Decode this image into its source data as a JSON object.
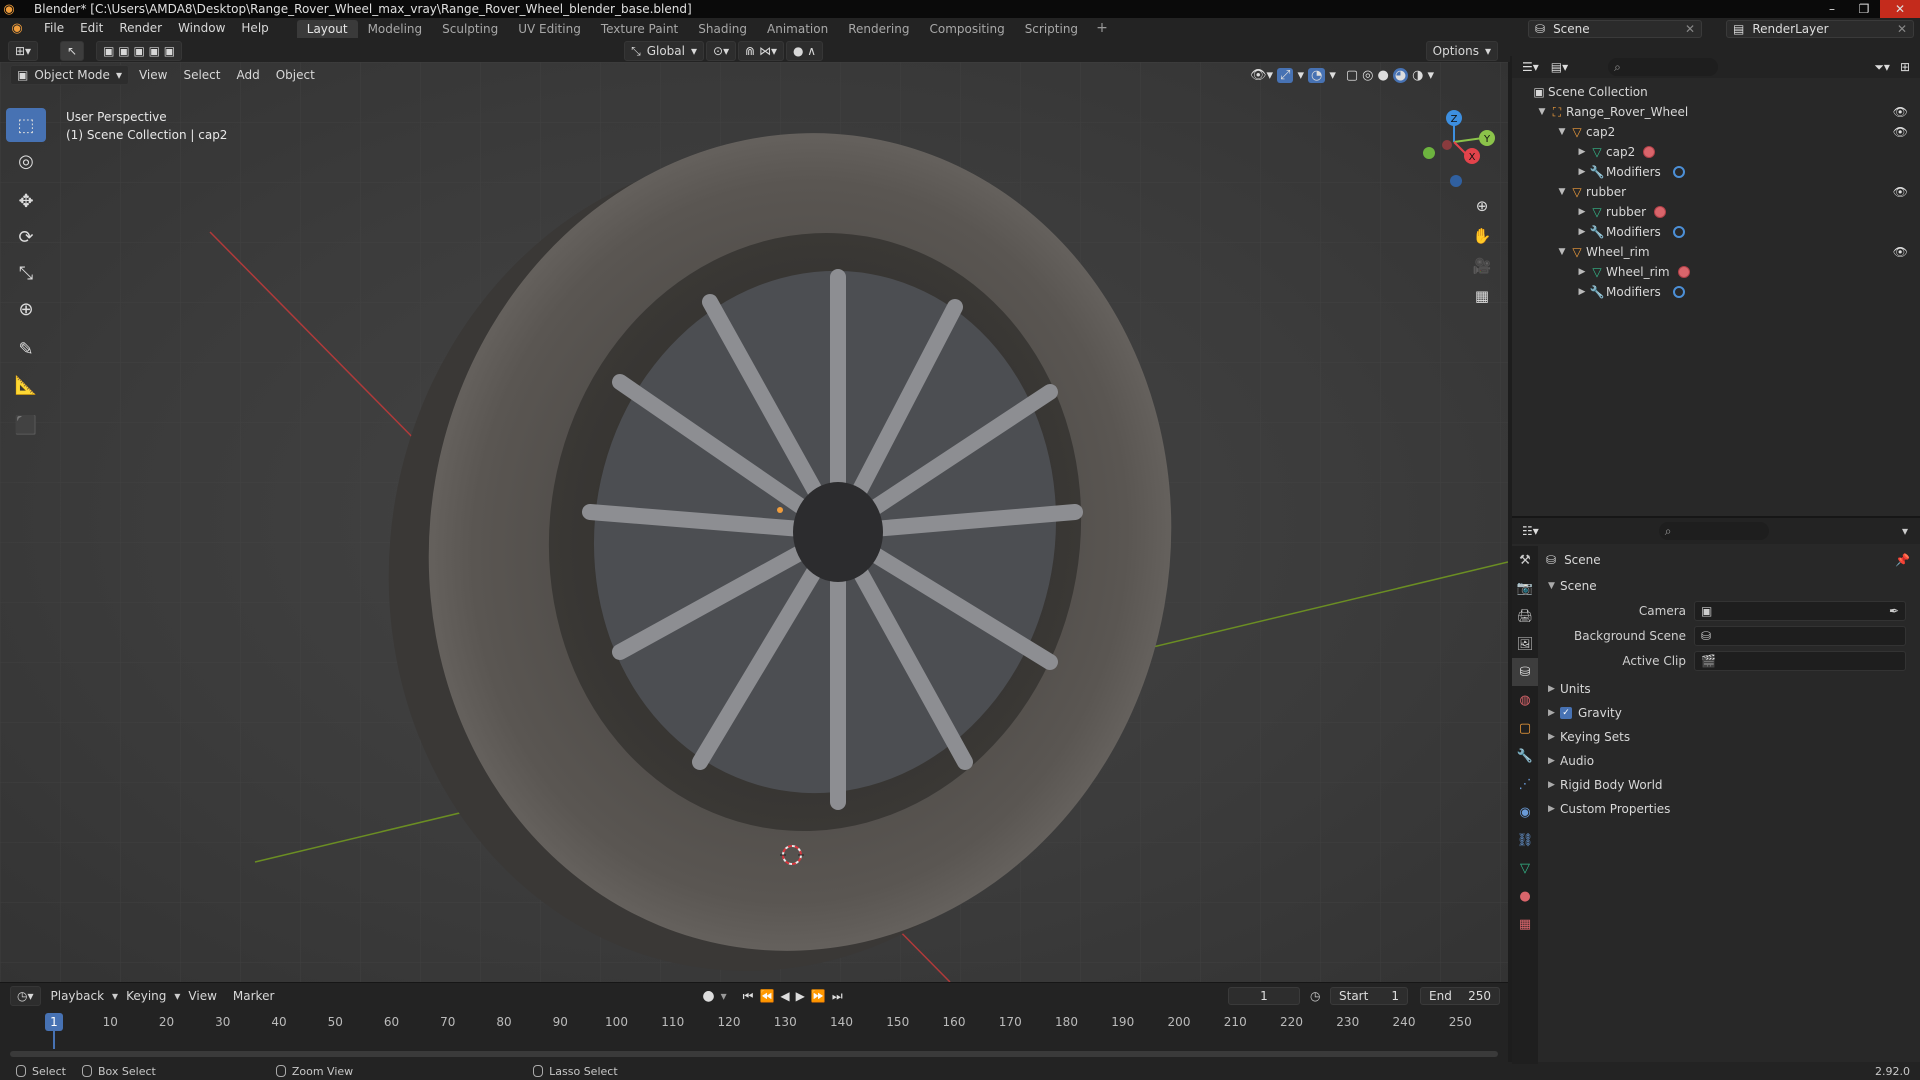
{
  "window": {
    "title": "Blender* [C:\\Users\\AMDA8\\Desktop\\Range_Rover_Wheel_max_vray\\Range_Rover_Wheel_blender_base.blend]",
    "buttons": [
      "–",
      "❐",
      "✕"
    ]
  },
  "menu": [
    "File",
    "Edit",
    "Render",
    "Window",
    "Help"
  ],
  "workspaces": [
    "Layout",
    "Modeling",
    "Sculpting",
    "UV Editing",
    "Texture Paint",
    "Shading",
    "Animation",
    "Rendering",
    "Compositing",
    "Scripting"
  ],
  "workspace_add": "+",
  "top_right": {
    "scene": "Scene",
    "render_layer": "RenderLayer"
  },
  "viewport": {
    "transform_orientation": "Global",
    "options_label": "Options",
    "mode": "Object Mode",
    "header_menu": [
      "View",
      "Select",
      "Add",
      "Object"
    ],
    "info_line1": "User Perspective",
    "info_line2": "(1) Scene Collection | cap2",
    "gizmo": {
      "x": "X",
      "y": "Y",
      "z": "Z"
    }
  },
  "timeline": {
    "menu": [
      "Playback",
      "Keying",
      "View",
      "Marker"
    ],
    "current_frame": "1",
    "start_label": "Start",
    "start": "1",
    "end_label": "End",
    "end": "250",
    "marker_frame": "1",
    "ticks": [
      "10",
      "20",
      "30",
      "40",
      "50",
      "60",
      "70",
      "80",
      "90",
      "100",
      "110",
      "120",
      "130",
      "140",
      "150",
      "160",
      "170",
      "180",
      "190",
      "200",
      "210",
      "220",
      "230",
      "240",
      "250"
    ]
  },
  "statusbar": {
    "items": [
      "Select",
      "Box Select",
      "Zoom View",
      "Lasso Select"
    ],
    "version": "2.92.0"
  },
  "outliner": {
    "root": "Scene Collection",
    "collection": "Range_Rover_Wheel",
    "objects": [
      {
        "name": "cap2",
        "mesh": "cap2",
        "modifiers": "Modifiers"
      },
      {
        "name": "rubber",
        "mesh": "rubber",
        "modifiers": "Modifiers"
      },
      {
        "name": "Wheel_rim",
        "mesh": "Wheel_rim",
        "modifiers": "Modifiers"
      }
    ]
  },
  "properties": {
    "context": "Scene",
    "panel": "Scene",
    "fields": {
      "camera": "Camera",
      "background_scene": "Background Scene",
      "active_clip": "Active Clip"
    },
    "sections": [
      "Units",
      "Gravity",
      "Keying Sets",
      "Audio",
      "Rigid Body World",
      "Custom Properties"
    ]
  },
  "colors": {
    "accent": "#4772b3",
    "axis_x": "#e2434b",
    "axis_y": "#8bc34a",
    "axis_z": "#3d8fe0",
    "blender_orange": "#f09d3c"
  }
}
